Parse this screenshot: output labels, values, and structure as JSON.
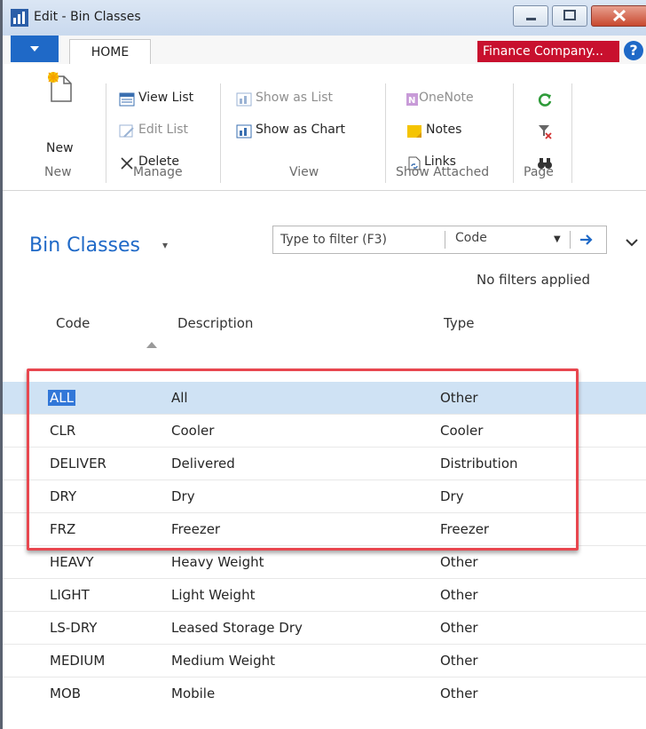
{
  "window": {
    "title": "Edit - Bin Classes"
  },
  "ribbon": {
    "tab_home": "HOME",
    "company": "Finance Company...",
    "help": "?",
    "groups": {
      "new": "New",
      "manage": "Manage",
      "view": "View",
      "show_attached": "Show Attached",
      "page": "Page"
    },
    "actions": {
      "new": "New",
      "view_list": "View List",
      "edit_list": "Edit List",
      "delete": "Delete",
      "show_as_list": "Show as List",
      "show_as_chart": "Show as Chart",
      "onenote": "OneNote",
      "notes": "Notes",
      "links": "Links"
    }
  },
  "list": {
    "title": "Bin Classes",
    "filter_placeholder": "Type to filter (F3)",
    "filter_field": "Code",
    "no_filters": "No filters applied",
    "columns": {
      "code": "Code",
      "description": "Description",
      "type": "Type"
    },
    "rows": [
      {
        "code": "ALL",
        "description": "All",
        "type": "Other"
      },
      {
        "code": "CLR",
        "description": "Cooler",
        "type": "Cooler"
      },
      {
        "code": "DELIVER",
        "description": "Delivered",
        "type": "Distribution"
      },
      {
        "code": "DRY",
        "description": "Dry",
        "type": "Dry"
      },
      {
        "code": "FRZ",
        "description": "Freezer",
        "type": "Freezer"
      },
      {
        "code": "HEAVY",
        "description": "Heavy Weight",
        "type": "Other"
      },
      {
        "code": "LIGHT",
        "description": "Light Weight",
        "type": "Other"
      },
      {
        "code": "LS-DRY",
        "description": "Leased Storage Dry",
        "type": "Other"
      },
      {
        "code": "MEDIUM",
        "description": "Medium Weight",
        "type": "Other"
      },
      {
        "code": "MOB",
        "description": "Mobile",
        "type": "Other"
      }
    ]
  },
  "colors": {
    "accent": "#1f69c7",
    "company_badge": "#c8102e",
    "selection": "#cfe2f4",
    "highlight_border": "#e8474f"
  },
  "icons": [
    "app-icon",
    "minimize-icon",
    "maximize-icon",
    "close-icon",
    "file-menu-icon",
    "help-icon",
    "new-icon",
    "view-list-icon",
    "edit-list-icon",
    "delete-icon",
    "show-as-list-icon",
    "show-as-chart-icon",
    "onenote-icon",
    "notes-icon",
    "links-icon",
    "refresh-icon",
    "clear-filter-icon",
    "find-icon",
    "dropdown-arrow-icon",
    "go-arrow-icon",
    "expand-chevron-icon",
    "sort-ascending-icon"
  ]
}
